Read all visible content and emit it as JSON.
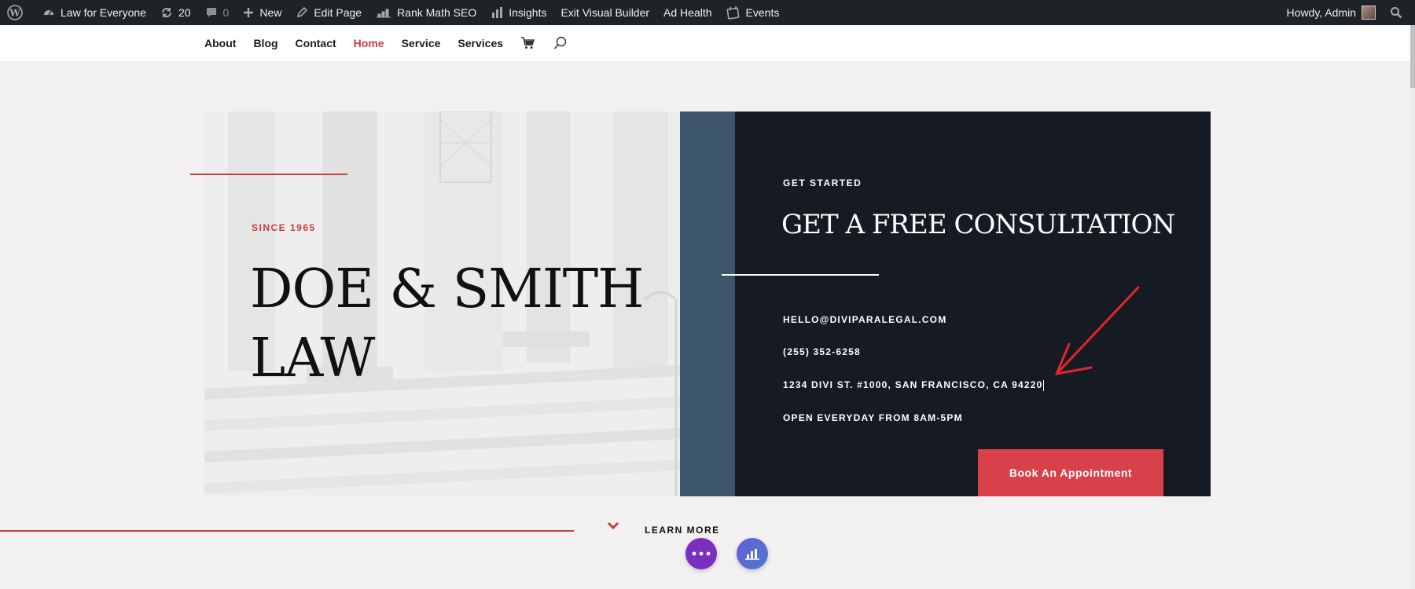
{
  "admin_bar": {
    "site_name": "Law for Everyone",
    "updates_count": "20",
    "comments_count": "0",
    "new_label": "New",
    "edit_page_label": "Edit Page",
    "rank_math_label": "Rank Math SEO",
    "insights_label": "Insights",
    "exit_builder_label": "Exit Visual Builder",
    "ad_health_label": "Ad Health",
    "events_label": "Events",
    "howdy_label": "Howdy, Admin"
  },
  "nav": {
    "items": [
      {
        "label": "About"
      },
      {
        "label": "Blog"
      },
      {
        "label": "Contact"
      },
      {
        "label": "Home"
      },
      {
        "label": "Service"
      },
      {
        "label": "Services"
      }
    ],
    "active_index": 3
  },
  "hero": {
    "since": "SINCE 1965",
    "name_line1": "DOE & SMITH",
    "name_line2": "LAW"
  },
  "consult": {
    "eyebrow": "GET STARTED",
    "title": "GET A FREE CONSULTATION",
    "email": "HELLO@DIVIPARALEGAL.COM",
    "phone": "(255) 352-6258",
    "address": "1234 DIVI ST. #1000, SAN FRANCISCO, CA 94220",
    "hours": "OPEN EVERYDAY FROM 8AM-5PM",
    "button_label": "Book An Appointment"
  },
  "bottom": {
    "learn_more": "LEARN MORE"
  },
  "colors": {
    "accent_red": "#c4403f",
    "button_red": "#d9414a",
    "dark_panel": "#161a22",
    "slate": "#3d546d",
    "admin_bar": "#1d2327",
    "fab_purple": "#7b2fbf"
  },
  "icons": [
    "wordpress-icon",
    "dashboard-icon",
    "updates-icon",
    "comment-icon",
    "plus-icon",
    "pencil-icon",
    "rank-math-icon",
    "insights-icon",
    "events-icon",
    "search-icon",
    "cart-icon",
    "nav-search-icon",
    "chevron-down-icon",
    "dots-icon",
    "chart-icon"
  ]
}
